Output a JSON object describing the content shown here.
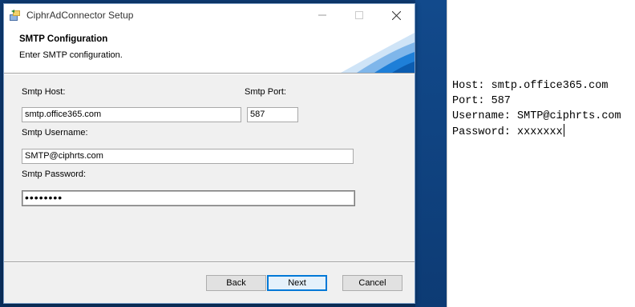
{
  "window": {
    "title": "CiphrAdConnector Setup"
  },
  "banner": {
    "title": "SMTP Configuration",
    "description": "Enter SMTP configuration."
  },
  "form": {
    "host_label": "Smtp Host:",
    "host_value": "smtp.office365.com",
    "port_label": "Smtp Port:",
    "port_value": "587",
    "username_label": "Smtp Username:",
    "username_value": "SMTP@ciphrts.com",
    "password_label": "Smtp Password:",
    "password_masked": "••••••••"
  },
  "buttons": {
    "back": "Back",
    "next": "Next",
    "cancel": "Cancel"
  },
  "notepad": {
    "lines": [
      "Host: smtp.office365.com",
      "Port: 587",
      "Username: SMTP@ciphrts.com",
      "Password: xxxxxxx"
    ]
  },
  "colors": {
    "desktop": "#0d3b74",
    "window_accent": "#0078d7",
    "banner_art": "#1e7fd8"
  },
  "icons": {
    "app": "installer-icon",
    "minimize": "minimize-icon",
    "maximize": "maximize-icon",
    "close": "close-icon"
  }
}
